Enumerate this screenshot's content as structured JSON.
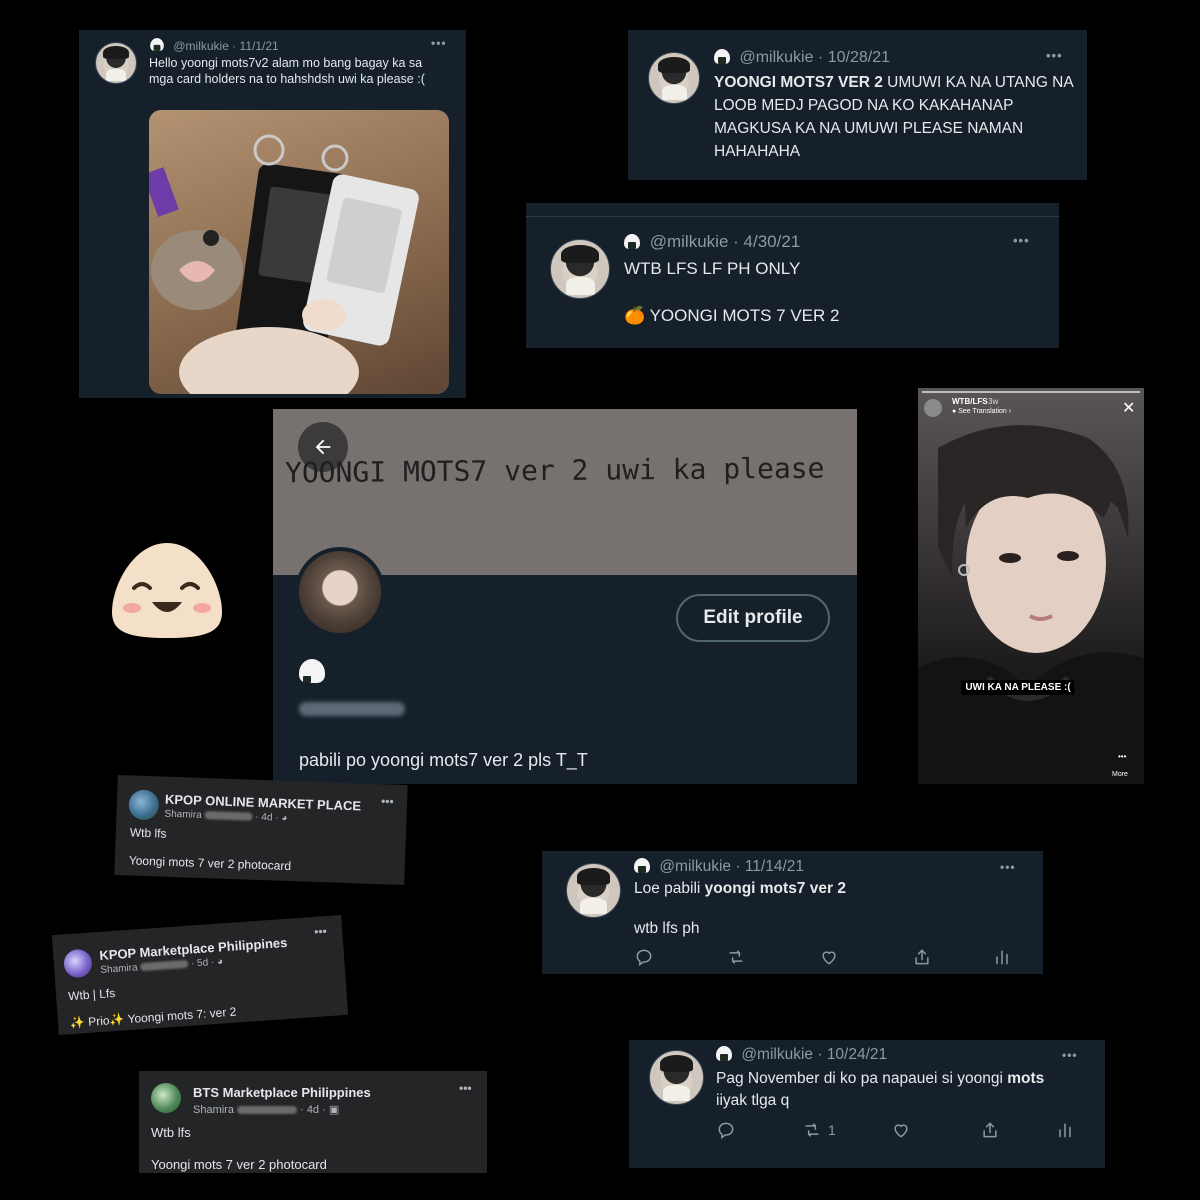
{
  "tweets": [
    {
      "handle": "@milkukie",
      "date": "11/1/21",
      "text": "Hello yoongi mots7v2 alam mo bang bagay ka sa mga card holders na to hahshdsh uwi ka please :("
    },
    {
      "handle": "@milkukie",
      "date": "10/28/21",
      "bold": "YOONGI MOTS7 VER 2",
      "text": " UMUWI KA NA UTANG NA LOOB MEDJ PAGOD NA KO KAKAHANAP MAGKUSA KA NA UMUWI PLEASE NAMAN HAHAHAHA"
    },
    {
      "handle": "@milkukie",
      "date": "4/30/21",
      "line1": "WTB LFS LF PH ONLY",
      "emoji": "🍊",
      "line2": "YOONGI MOTS 7 VER 2"
    },
    {
      "handle": "@milkukie",
      "date": "11/14/21",
      "plain": "Loe pabili ",
      "bold": "yoongi mots7 ver 2",
      "line2": "wtb lfs ph"
    },
    {
      "handle": "@milkukie",
      "date": "10/24/21",
      "plain": "Pag November di ko pa napauei si yoongi ",
      "bold": "mots",
      "line2": "iiyak tlga q",
      "retweet_count": "1"
    }
  ],
  "profile": {
    "banner_text": "YOONGI MOTS7 ver 2 uwi ka please",
    "edit_button": "Edit profile",
    "bio": "pabili po yoongi mots7 ver 2 pls T_T"
  },
  "story": {
    "user": "WTB/LFS",
    "time": "3w",
    "translation": "See Translation",
    "caption": "UWI KA NA PLEASE :(",
    "more": "More"
  },
  "fb_posts": [
    {
      "group": "KPOP ONLINE MARKET PLACE",
      "author": "Shamira",
      "time": "4d",
      "line1": "Wtb lfs",
      "line2": "Yoongi mots 7 ver 2 photocard"
    },
    {
      "group": "KPOP Marketplace Philippines",
      "author": "Shamira",
      "time": "5d",
      "line1": "Wtb | Lfs",
      "line2": "✨ Prio✨ Yoongi mots 7: ver 2"
    },
    {
      "group": "BTS Marketplace Philippines",
      "author": "Shamira",
      "time": "4d",
      "line1": "Wtb lfs",
      "line2": "Yoongi mots 7 ver 2 photocard"
    }
  ],
  "colors": {
    "tweet_bg": "#15202b",
    "fb_bg": "#242526",
    "muted": "#8b98a5",
    "page_bg": "#000000"
  }
}
